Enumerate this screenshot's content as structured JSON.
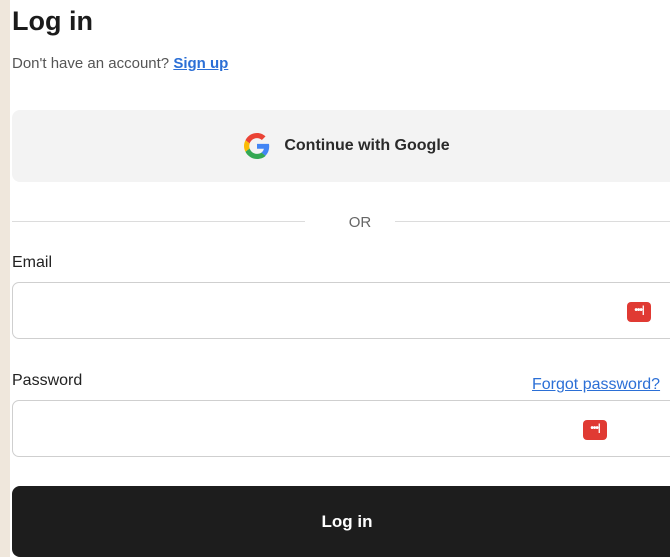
{
  "page": {
    "title": "Log in",
    "signup_prompt": "Don't have an account?",
    "signup_link": "Sign up"
  },
  "google": {
    "label": "Continue with Google"
  },
  "divider": {
    "text": "OR"
  },
  "email": {
    "label": "Email",
    "value": "",
    "placeholder": ""
  },
  "password": {
    "label": "Password",
    "value": "",
    "placeholder": "",
    "forgot_link": "Forgot password?"
  },
  "submit": {
    "label": "Log in"
  },
  "icons": {
    "google": "google-icon",
    "password_manager": "password-manager-icon"
  },
  "colors": {
    "link": "#2b6fd6",
    "primary_button": "#1d1d1d",
    "google_button": "#f3f3f3",
    "pm_icon": "#e03a33"
  }
}
